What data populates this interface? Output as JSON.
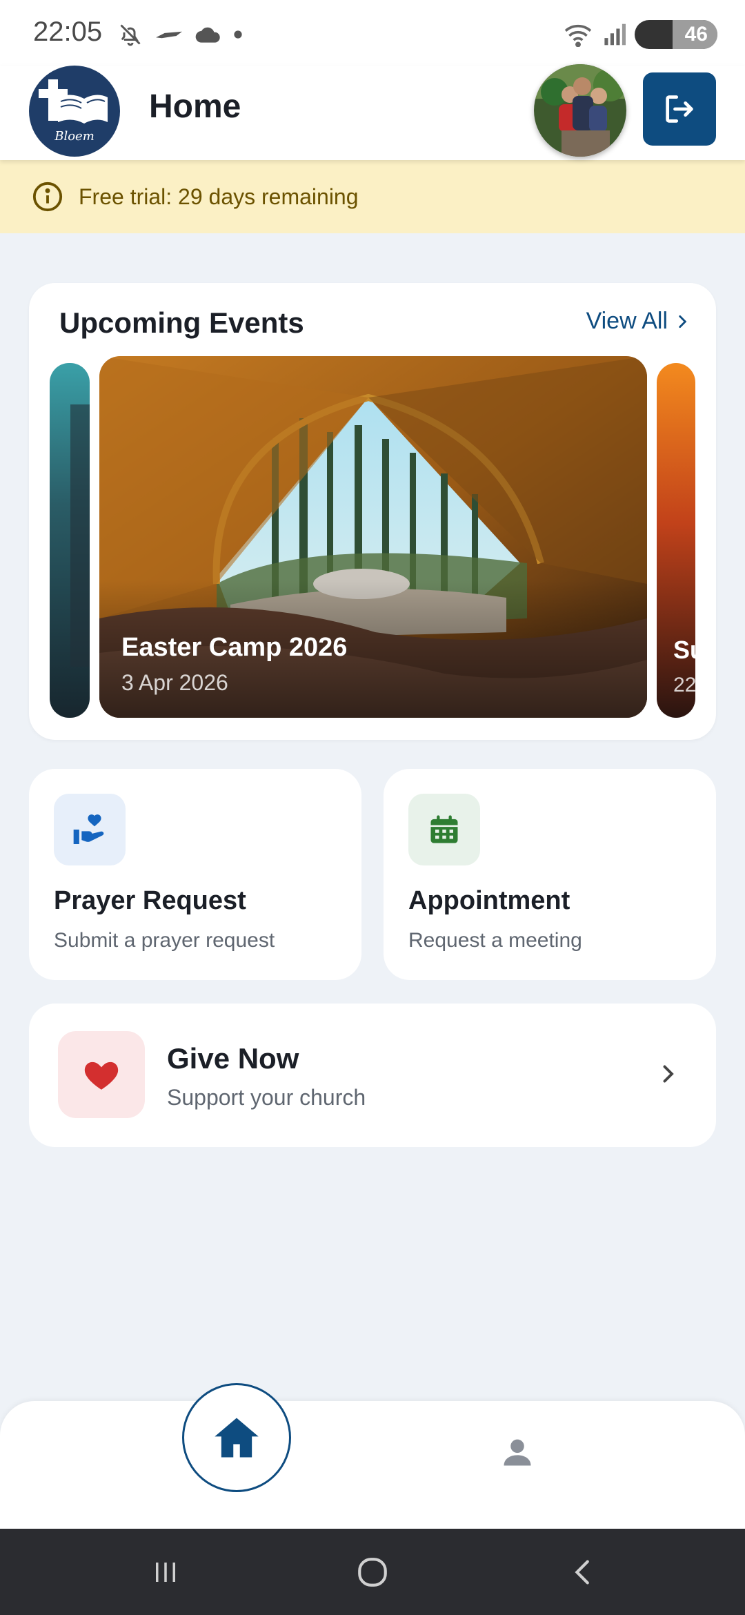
{
  "status_bar": {
    "time": "22:05",
    "battery": "46",
    "icons_left": [
      "bell-off-icon",
      "hammerhead-icon",
      "cloud-icon",
      "dot-icon"
    ],
    "icons_right": [
      "wifi-icon",
      "signal-icon",
      "battery-icon"
    ]
  },
  "header": {
    "title": "Home",
    "logo_text": "Bloem",
    "colors": {
      "brand": "#0e4c80",
      "logo_bg": "#1f3d68"
    }
  },
  "trial_banner": {
    "text": "Free trial: 29 days remaining",
    "icon": "info-icon",
    "colors": {
      "bg": "#fbf0c5",
      "text": "#6b5200"
    }
  },
  "events": {
    "title": "Upcoming Events",
    "view_all_label": "View All",
    "items": [
      {
        "name": "Easter Camp 2026",
        "date": "3 Apr 2026"
      },
      {
        "name": "Su",
        "date": "22"
      }
    ]
  },
  "actions": [
    {
      "title": "Prayer Request",
      "subtitle": "Submit a prayer request",
      "icon": "prayer-hand-heart-icon",
      "icon_bg": "#e7effa",
      "icon_color": "#1565c0"
    },
    {
      "title": "Appointment",
      "subtitle": "Request a meeting",
      "icon": "calendar-icon",
      "icon_bg": "#e8f2ea",
      "icon_color": "#2e7d32"
    }
  ],
  "give": {
    "title": "Give Now",
    "subtitle": "Support your church",
    "icon": "heart-icon",
    "icon_color": "#d32f2f"
  },
  "bottom_nav": {
    "items": [
      "home-icon",
      "person-icon"
    ],
    "active": "home-icon"
  },
  "system_nav": [
    "recents-icon",
    "home-circle-icon",
    "back-icon"
  ]
}
